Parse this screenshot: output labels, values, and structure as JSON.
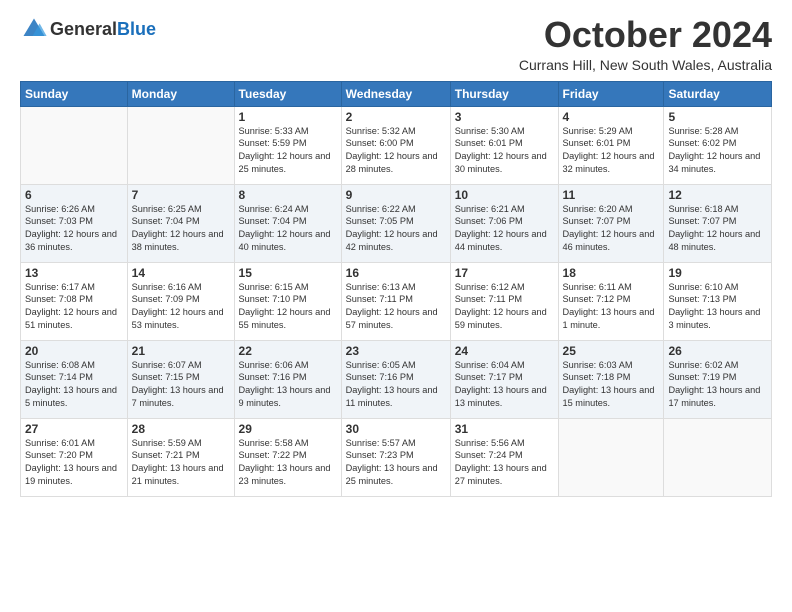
{
  "header": {
    "logo_general": "General",
    "logo_blue": "Blue",
    "month": "October 2024",
    "location": "Currans Hill, New South Wales, Australia"
  },
  "weekdays": [
    "Sunday",
    "Monday",
    "Tuesday",
    "Wednesday",
    "Thursday",
    "Friday",
    "Saturday"
  ],
  "weeks": [
    [
      {
        "day": "",
        "sunrise": "",
        "sunset": "",
        "daylight": ""
      },
      {
        "day": "",
        "sunrise": "",
        "sunset": "",
        "daylight": ""
      },
      {
        "day": "1",
        "sunrise": "Sunrise: 5:33 AM",
        "sunset": "Sunset: 5:59 PM",
        "daylight": "Daylight: 12 hours and 25 minutes."
      },
      {
        "day": "2",
        "sunrise": "Sunrise: 5:32 AM",
        "sunset": "Sunset: 6:00 PM",
        "daylight": "Daylight: 12 hours and 28 minutes."
      },
      {
        "day": "3",
        "sunrise": "Sunrise: 5:30 AM",
        "sunset": "Sunset: 6:01 PM",
        "daylight": "Daylight: 12 hours and 30 minutes."
      },
      {
        "day": "4",
        "sunrise": "Sunrise: 5:29 AM",
        "sunset": "Sunset: 6:01 PM",
        "daylight": "Daylight: 12 hours and 32 minutes."
      },
      {
        "day": "5",
        "sunrise": "Sunrise: 5:28 AM",
        "sunset": "Sunset: 6:02 PM",
        "daylight": "Daylight: 12 hours and 34 minutes."
      }
    ],
    [
      {
        "day": "6",
        "sunrise": "Sunrise: 6:26 AM",
        "sunset": "Sunset: 7:03 PM",
        "daylight": "Daylight: 12 hours and 36 minutes."
      },
      {
        "day": "7",
        "sunrise": "Sunrise: 6:25 AM",
        "sunset": "Sunset: 7:04 PM",
        "daylight": "Daylight: 12 hours and 38 minutes."
      },
      {
        "day": "8",
        "sunrise": "Sunrise: 6:24 AM",
        "sunset": "Sunset: 7:04 PM",
        "daylight": "Daylight: 12 hours and 40 minutes."
      },
      {
        "day": "9",
        "sunrise": "Sunrise: 6:22 AM",
        "sunset": "Sunset: 7:05 PM",
        "daylight": "Daylight: 12 hours and 42 minutes."
      },
      {
        "day": "10",
        "sunrise": "Sunrise: 6:21 AM",
        "sunset": "Sunset: 7:06 PM",
        "daylight": "Daylight: 12 hours and 44 minutes."
      },
      {
        "day": "11",
        "sunrise": "Sunrise: 6:20 AM",
        "sunset": "Sunset: 7:07 PM",
        "daylight": "Daylight: 12 hours and 46 minutes."
      },
      {
        "day": "12",
        "sunrise": "Sunrise: 6:18 AM",
        "sunset": "Sunset: 7:07 PM",
        "daylight": "Daylight: 12 hours and 48 minutes."
      }
    ],
    [
      {
        "day": "13",
        "sunrise": "Sunrise: 6:17 AM",
        "sunset": "Sunset: 7:08 PM",
        "daylight": "Daylight: 12 hours and 51 minutes."
      },
      {
        "day": "14",
        "sunrise": "Sunrise: 6:16 AM",
        "sunset": "Sunset: 7:09 PM",
        "daylight": "Daylight: 12 hours and 53 minutes."
      },
      {
        "day": "15",
        "sunrise": "Sunrise: 6:15 AM",
        "sunset": "Sunset: 7:10 PM",
        "daylight": "Daylight: 12 hours and 55 minutes."
      },
      {
        "day": "16",
        "sunrise": "Sunrise: 6:13 AM",
        "sunset": "Sunset: 7:11 PM",
        "daylight": "Daylight: 12 hours and 57 minutes."
      },
      {
        "day": "17",
        "sunrise": "Sunrise: 6:12 AM",
        "sunset": "Sunset: 7:11 PM",
        "daylight": "Daylight: 12 hours and 59 minutes."
      },
      {
        "day": "18",
        "sunrise": "Sunrise: 6:11 AM",
        "sunset": "Sunset: 7:12 PM",
        "daylight": "Daylight: 13 hours and 1 minute."
      },
      {
        "day": "19",
        "sunrise": "Sunrise: 6:10 AM",
        "sunset": "Sunset: 7:13 PM",
        "daylight": "Daylight: 13 hours and 3 minutes."
      }
    ],
    [
      {
        "day": "20",
        "sunrise": "Sunrise: 6:08 AM",
        "sunset": "Sunset: 7:14 PM",
        "daylight": "Daylight: 13 hours and 5 minutes."
      },
      {
        "day": "21",
        "sunrise": "Sunrise: 6:07 AM",
        "sunset": "Sunset: 7:15 PM",
        "daylight": "Daylight: 13 hours and 7 minutes."
      },
      {
        "day": "22",
        "sunrise": "Sunrise: 6:06 AM",
        "sunset": "Sunset: 7:16 PM",
        "daylight": "Daylight: 13 hours and 9 minutes."
      },
      {
        "day": "23",
        "sunrise": "Sunrise: 6:05 AM",
        "sunset": "Sunset: 7:16 PM",
        "daylight": "Daylight: 13 hours and 11 minutes."
      },
      {
        "day": "24",
        "sunrise": "Sunrise: 6:04 AM",
        "sunset": "Sunset: 7:17 PM",
        "daylight": "Daylight: 13 hours and 13 minutes."
      },
      {
        "day": "25",
        "sunrise": "Sunrise: 6:03 AM",
        "sunset": "Sunset: 7:18 PM",
        "daylight": "Daylight: 13 hours and 15 minutes."
      },
      {
        "day": "26",
        "sunrise": "Sunrise: 6:02 AM",
        "sunset": "Sunset: 7:19 PM",
        "daylight": "Daylight: 13 hours and 17 minutes."
      }
    ],
    [
      {
        "day": "27",
        "sunrise": "Sunrise: 6:01 AM",
        "sunset": "Sunset: 7:20 PM",
        "daylight": "Daylight: 13 hours and 19 minutes."
      },
      {
        "day": "28",
        "sunrise": "Sunrise: 5:59 AM",
        "sunset": "Sunset: 7:21 PM",
        "daylight": "Daylight: 13 hours and 21 minutes."
      },
      {
        "day": "29",
        "sunrise": "Sunrise: 5:58 AM",
        "sunset": "Sunset: 7:22 PM",
        "daylight": "Daylight: 13 hours and 23 minutes."
      },
      {
        "day": "30",
        "sunrise": "Sunrise: 5:57 AM",
        "sunset": "Sunset: 7:23 PM",
        "daylight": "Daylight: 13 hours and 25 minutes."
      },
      {
        "day": "31",
        "sunrise": "Sunrise: 5:56 AM",
        "sunset": "Sunset: 7:24 PM",
        "daylight": "Daylight: 13 hours and 27 minutes."
      },
      {
        "day": "",
        "sunrise": "",
        "sunset": "",
        "daylight": ""
      },
      {
        "day": "",
        "sunrise": "",
        "sunset": "",
        "daylight": ""
      }
    ]
  ]
}
